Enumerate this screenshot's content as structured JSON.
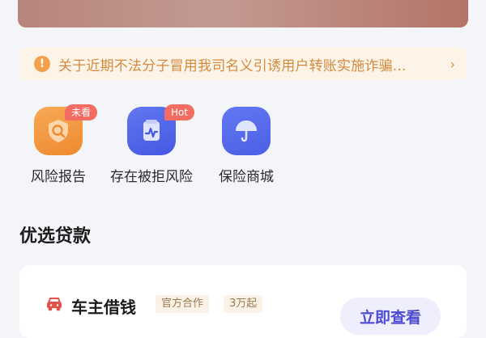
{
  "notice": {
    "text": "关于近期不法分子冒用我司名义引诱用户转账实施诈骗...",
    "icon": "exclamation-icon",
    "arrow": "›"
  },
  "quick_actions": [
    {
      "label": "风险报告",
      "badge": "未看",
      "icon": "magnifier-shield-icon",
      "color": "#f3953d"
    },
    {
      "label": "存在被拒风险",
      "badge": "Hot",
      "icon": "pulse-chart-icon",
      "color": "#4e62e8"
    },
    {
      "label": "保险商城",
      "badge": "",
      "icon": "umbrella-icon",
      "color": "#5064ea"
    }
  ],
  "section": {
    "title": "优选贷款"
  },
  "loan_card": {
    "name": "车主借钱",
    "tags": [
      "官方合作",
      "3万起"
    ],
    "button": "立即查看"
  }
}
